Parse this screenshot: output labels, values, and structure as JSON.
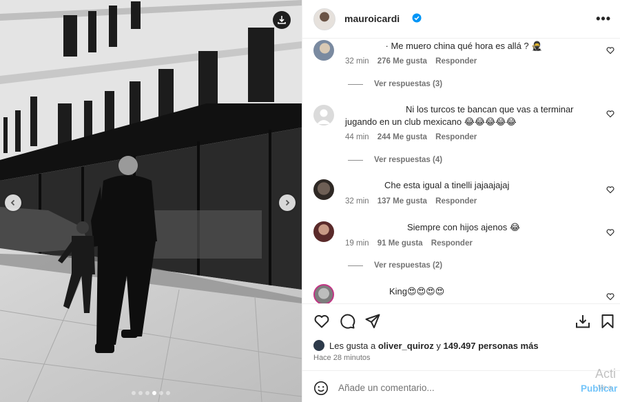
{
  "post": {
    "username": "mauroicardi",
    "more_label": "•••",
    "carousel_dots": 6,
    "active_dot": 3
  },
  "comments": [
    {
      "text": "· Me muero china qué hora es allá ? 🥷",
      "time": "32 min",
      "likes": "276 Me gusta",
      "reply": "Responder",
      "view_replies": "Ver respuestas (3)"
    },
    {
      "text": "Ni los turcos te bancan que vas a terminar jugando en un club mexicano 😂😂😂😂😂",
      "time": "44 min",
      "likes": "244 Me gusta",
      "reply": "Responder",
      "view_replies": "Ver respuestas (4)"
    },
    {
      "text": "Che esta igual a tinelli jajaajajaj",
      "time": "32 min",
      "likes": "137 Me gusta",
      "reply": "Responder"
    },
    {
      "text": "Siempre con hijos ajenos 😂",
      "time": "19 min",
      "likes": "91 Me gusta",
      "reply": "Responder",
      "view_replies": "Ver respuestas (2)"
    },
    {
      "text": "King😍😍😍😍"
    }
  ],
  "likes_summary": {
    "prefix": "Les gusta a",
    "user": "oliver_quiroz",
    "connector": "y",
    "count": "149.497 personas más"
  },
  "time_ago": "Hace 28 minutos",
  "add_comment": {
    "placeholder": "Añade un comentario...",
    "publish": "Publicar"
  },
  "watermark": {
    "line1": "Acti",
    "line2": "Ve a"
  },
  "colors": {
    "accent": "#0095f6",
    "verified": "#0095f6",
    "text": "#262626",
    "muted": "#737373"
  }
}
